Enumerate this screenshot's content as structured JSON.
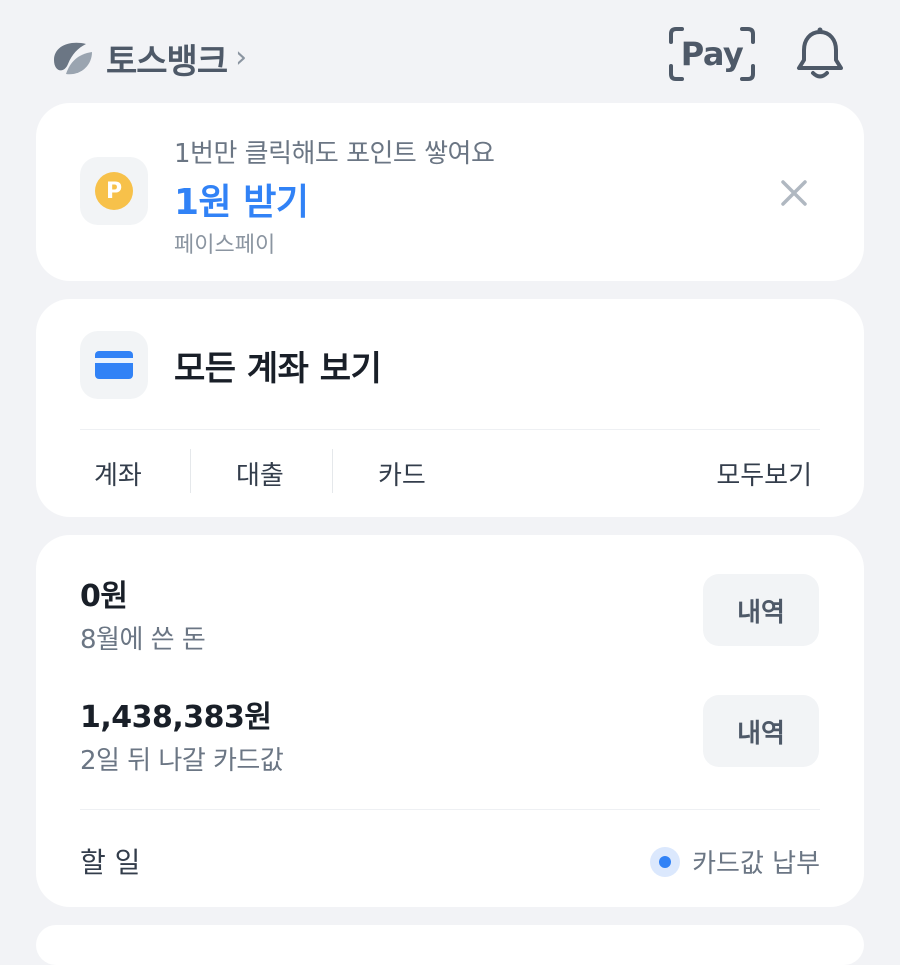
{
  "header": {
    "brand_name": "토스뱅크",
    "pay_label": "Pay",
    "icons": [
      "toss-logo-icon",
      "chevron-right-icon",
      "pay-scan-icon",
      "bell-icon"
    ]
  },
  "promo": {
    "subtitle": "1번만 클릭해도 포인트 쌓여요",
    "cta": "1원 받기",
    "source": "페이스페이",
    "coin_letter": "P",
    "icons": [
      "point-coin-icon",
      "close-icon"
    ]
  },
  "accounts": {
    "title": "모든 계좌 보기",
    "tabs": [
      "계좌",
      "대출",
      "카드"
    ],
    "view_all": "모두보기",
    "icons": [
      "card-icon"
    ]
  },
  "spending": {
    "rows": [
      {
        "amount": "0원",
        "label": "8월에 쓴 돈",
        "button": "내역"
      },
      {
        "amount": "1,438,383원",
        "label": "2일 뒤 나갈 카드값",
        "button": "내역"
      }
    ],
    "todo_label": "할 일",
    "todo_item": "카드값 납부",
    "icons": [
      "status-dot-icon"
    ]
  },
  "colors": {
    "background": "#f2f3f6",
    "card": "#ffffff",
    "accent_blue": "#3182f6",
    "coin_yellow": "#f7c14a",
    "text_primary": "#191f28",
    "text_secondary": "#6b7684"
  }
}
